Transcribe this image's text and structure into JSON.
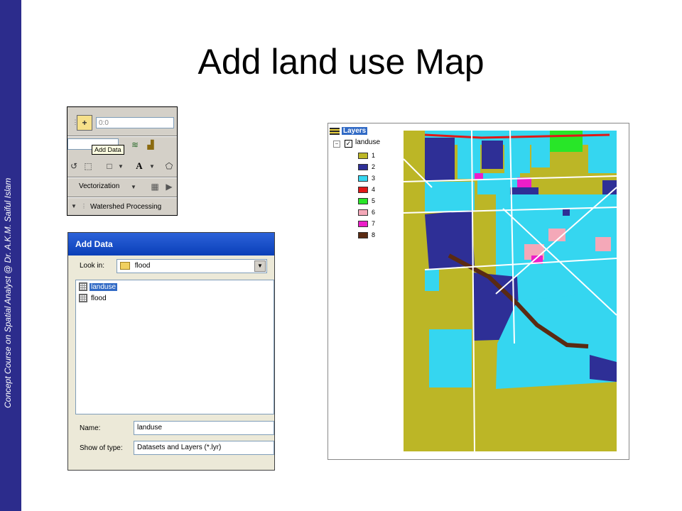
{
  "slide": {
    "title": "Add land use Map",
    "side_text": "Concept Course on Spatial Analyst @ Dr. A.K.M. Saiful Islam"
  },
  "toolbar": {
    "scale_value": "0:0",
    "tooltip": "Add Data",
    "text_tool": "A",
    "vectorization_label": "Vectorization",
    "watershed_label": "Watershed Processing"
  },
  "add_data_dialog": {
    "title": "Add Data",
    "look_in_label": "Look in:",
    "look_in_value": "flood",
    "files": [
      {
        "name": "landuse",
        "selected": true
      },
      {
        "name": "flood",
        "selected": false
      }
    ],
    "name_label": "Name:",
    "name_value": "landuse",
    "show_type_label": "Show of type:",
    "show_type_value": "Datasets and Layers (*.lyr)"
  },
  "toc": {
    "root_label": "Layers",
    "layer_name": "landuse",
    "legend": [
      {
        "label": "1",
        "color": "#bcb626"
      },
      {
        "label": "2",
        "color": "#2e2f96"
      },
      {
        "label": "3",
        "color": "#35d6f0"
      },
      {
        "label": "4",
        "color": "#e01818"
      },
      {
        "label": "5",
        "color": "#28e628"
      },
      {
        "label": "6",
        "color": "#f4a8b8"
      },
      {
        "label": "7",
        "color": "#ec1ec8"
      },
      {
        "label": "8",
        "color": "#5a2a12"
      }
    ]
  }
}
